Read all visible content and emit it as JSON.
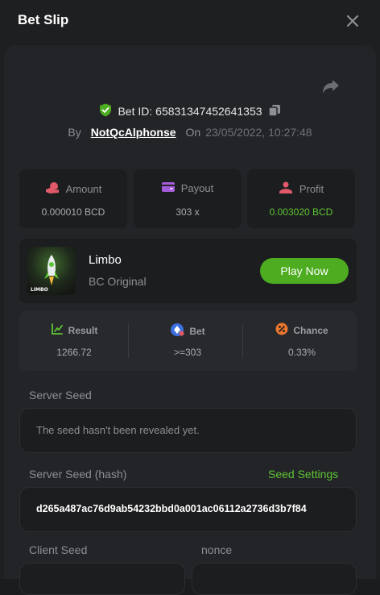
{
  "header": {
    "title": "Bet Slip"
  },
  "bet": {
    "id_label": "Bet ID: 65831347452641353",
    "by_label": "By",
    "username": "NotQcAlphonse",
    "on_label": "On",
    "datetime": "23/05/2022, 10:27:48"
  },
  "stats": {
    "amount_label": "Amount",
    "amount_value": "0.000010 BCD",
    "payout_label": "Payout",
    "payout_value": "303 x",
    "profit_label": "Profit",
    "profit_value": "0.003020 BCD"
  },
  "game": {
    "name": "Limbo",
    "subtitle": "BC Original",
    "thumb_text": "LIMBO",
    "play_label": "Play Now"
  },
  "result": {
    "result_label": "Result",
    "result_value": "1266.72",
    "bet_label": "Bet",
    "bet_value": ">=303",
    "chance_label": "Chance",
    "chance_value": "0.33%"
  },
  "seeds": {
    "server_seed_label": "Server Seed",
    "server_seed_value": "The seed hasn't been revealed yet.",
    "server_hash_label": "Server Seed (hash)",
    "seed_settings_label": "Seed Settings",
    "server_hash_value": "d265a487ac76d9ab54232bbd0a001ac06112a2736d3b7f84",
    "client_seed_label": "Client Seed",
    "nonce_label": "nonce"
  },
  "colors": {
    "accent_green": "#5ec534",
    "play_button": "#4dac20",
    "panel_bg": "#232427",
    "card_bg": "#1c1d1f"
  },
  "icons": {
    "bet_id": "shield-check-icon",
    "copy": "copy-icon",
    "share": "share-icon",
    "amount": "coins-icon",
    "payout": "wallet-icon",
    "profit": "profit-icon",
    "result": "chart-icon",
    "bet": "bet-icon",
    "chance": "percent-icon",
    "close": "close-icon"
  }
}
